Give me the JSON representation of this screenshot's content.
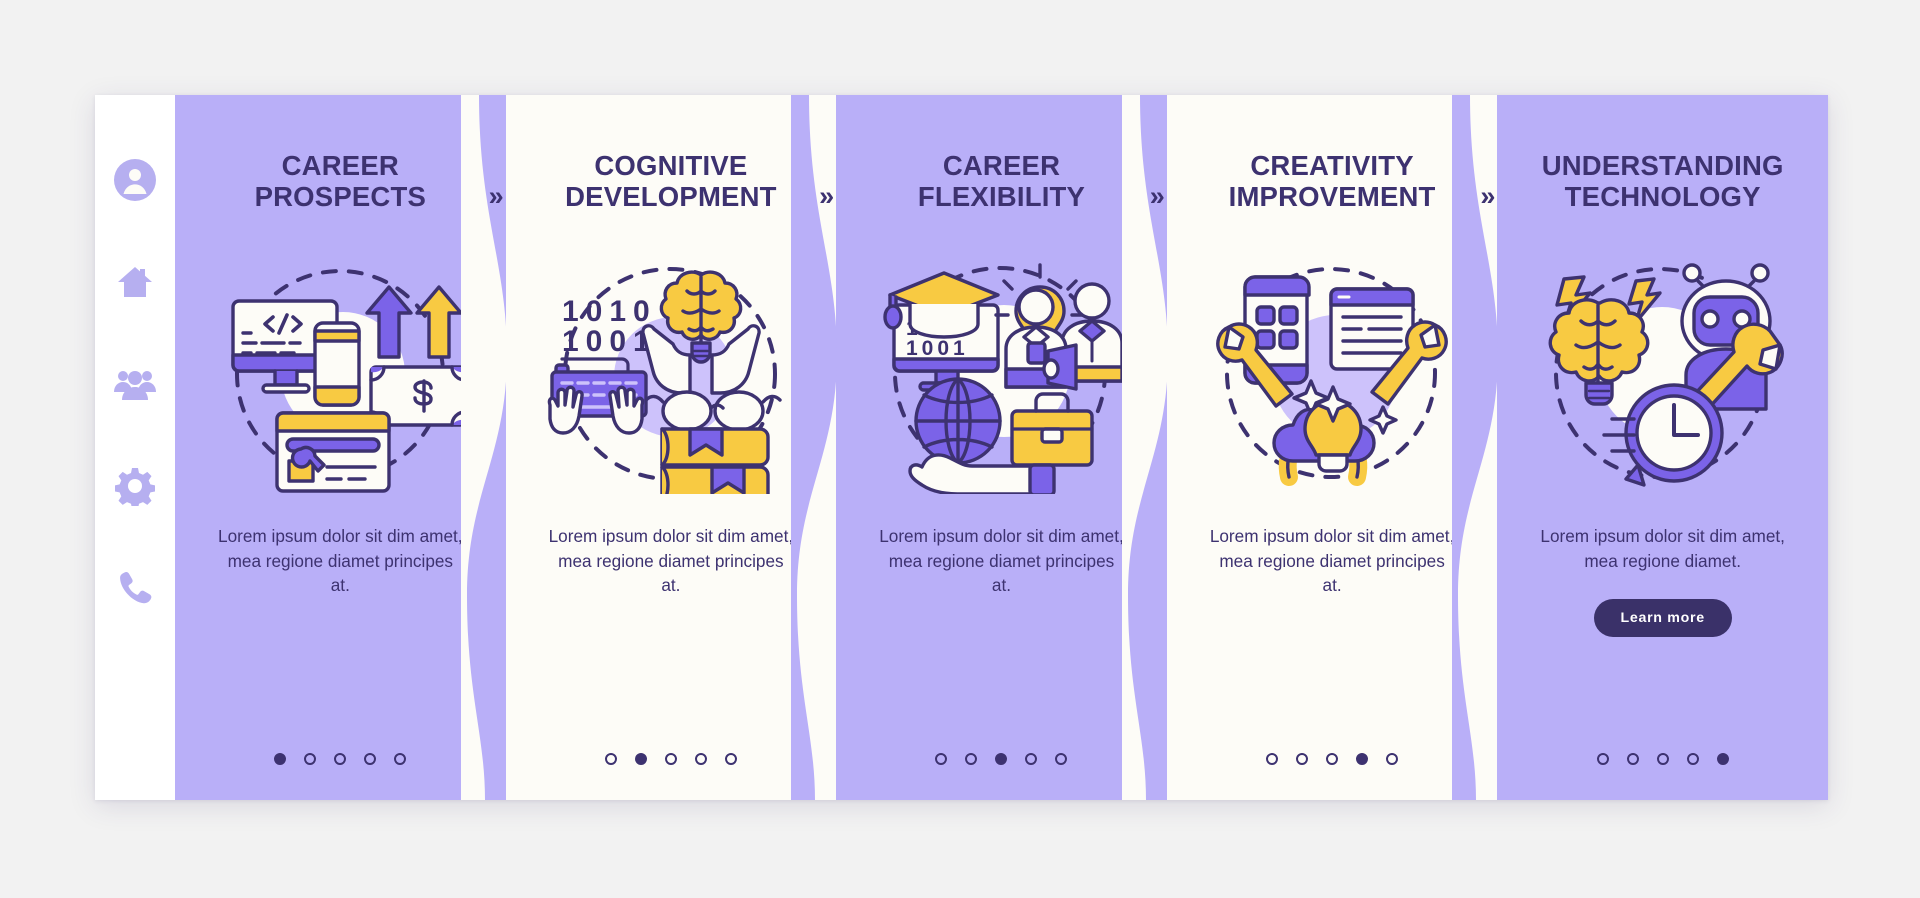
{
  "app": {
    "background_color": "#f2f2f2",
    "card_violet": "#b9aff8",
    "card_white": "#fdfcf7",
    "ink": "#3d3270",
    "accent_yellow": "#f8ca42",
    "accent_purple": "#7b63e8",
    "sidebar_icon_color": "#b6aff0",
    "button_color": "#3a3169"
  },
  "sidebar": {
    "items": [
      {
        "icon": "user-avatar-icon",
        "name": "sidebar-item-profile"
      },
      {
        "icon": "home-icon",
        "name": "sidebar-item-home"
      },
      {
        "icon": "people-group-icon",
        "name": "sidebar-item-team"
      },
      {
        "icon": "gear-icon",
        "name": "sidebar-item-settings"
      },
      {
        "icon": "phone-icon",
        "name": "sidebar-item-contact"
      }
    ]
  },
  "separator": {
    "glyph": "»",
    "label": "next-step-chevron"
  },
  "cards": [
    {
      "title": "Career Prospects",
      "body": "Lorem ipsum dolor sit dim amet, mea regione diamet principes at.",
      "theme": "violet",
      "illustration": "career-prospects-illustration",
      "dots": {
        "count": 5,
        "active": 1
      },
      "cta": null
    },
    {
      "title": "Cognitive Development",
      "body": "Lorem ipsum dolor sit dim amet, mea regione diamet principes at.",
      "theme": "white",
      "illustration": "cognitive-development-illustration",
      "dots": {
        "count": 5,
        "active": 2
      },
      "cta": null
    },
    {
      "title": "Career Flexibility",
      "body": "Lorem ipsum dolor sit dim amet, mea regione diamet principes at.",
      "theme": "violet",
      "illustration": "career-flexibility-illustration",
      "dots": {
        "count": 5,
        "active": 3
      },
      "cta": null
    },
    {
      "title": "Creativity Improvement",
      "body": "Lorem ipsum dolor sit dim amet, mea regione diamet principes at.",
      "theme": "white",
      "illustration": "creativity-improvement-illustration",
      "dots": {
        "count": 5,
        "active": 4
      },
      "cta": null
    },
    {
      "title": "Understanding Technology",
      "body": "Lorem ipsum dolor sit dim amet, mea regione diamet.",
      "theme": "violet",
      "illustration": "understanding-technology-illustration",
      "dots": {
        "count": 5,
        "active": 5
      },
      "cta": "Learn more"
    }
  ]
}
